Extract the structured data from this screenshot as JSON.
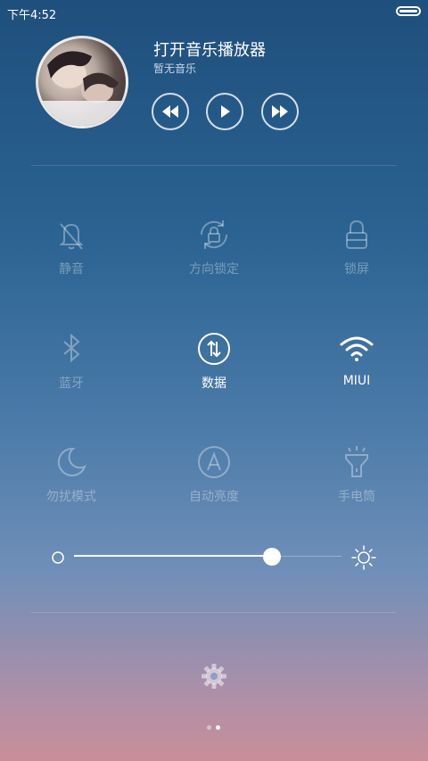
{
  "status_bar": {
    "time": "下午4:52",
    "battery_level": 1.0
  },
  "music": {
    "title": "打开音乐播放器",
    "subtitle": "暂无音乐",
    "controls": [
      "previous-icon",
      "play-icon",
      "next-icon"
    ]
  },
  "toggles": [
    {
      "label": "静音",
      "icon": "bell-muted-icon",
      "active": false
    },
    {
      "label": "方向锁定",
      "icon": "rotation-lock-icon",
      "active": false
    },
    {
      "label": "锁屏",
      "icon": "lock-icon",
      "active": false
    },
    {
      "label": "蓝牙",
      "icon": "bluetooth-icon",
      "active": false
    },
    {
      "label": "数据",
      "icon": "mobile-data-icon",
      "active": true
    },
    {
      "label": "MIUI",
      "icon": "wifi-icon",
      "active": true
    },
    {
      "label": "勿扰模式",
      "icon": "moon-icon",
      "active": false
    },
    {
      "label": "自动亮度",
      "icon": "auto-brightness-icon",
      "active": false
    },
    {
      "label": "手电筒",
      "icon": "flashlight-icon",
      "active": false
    }
  ],
  "brightness": {
    "value": 0.74
  },
  "pager": {
    "count": 2,
    "current": 2
  },
  "colors": {
    "active": "#ffffff",
    "inactive": "rgba(255,255,255,0.35)"
  }
}
